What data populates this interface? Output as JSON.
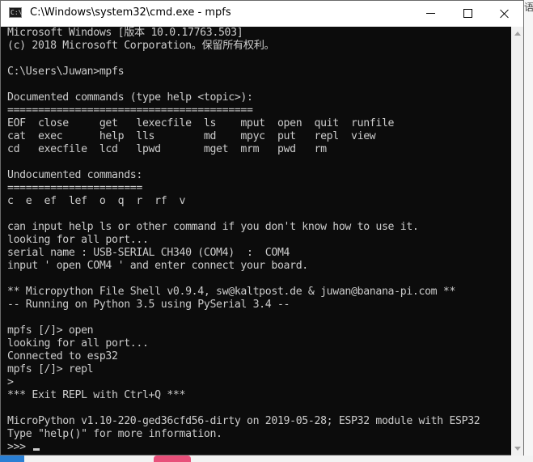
{
  "window": {
    "title": "C:\\Windows\\system32\\cmd.exe - mpfs",
    "icon": "cmd-icon",
    "icon_glyph": "C:\\"
  },
  "controls": {
    "minimize_icon": "minimize-icon",
    "maximize_icon": "maximize-icon",
    "close_icon": "close-icon"
  },
  "console": {
    "lines": [
      "Microsoft Windows [版本 10.0.17763.503]",
      "(c) 2018 Microsoft Corporation。保留所有权利。",
      "",
      "C:\\Users\\Juwan>mpfs",
      "",
      "Documented commands (type help <topic>):",
      "========================================",
      "EOF  close     get   lexecfile  ls    mput  open  quit  runfile",
      "cat  exec      help  lls        md    mpyc  put   repl  view",
      "cd   execfile  lcd   lpwd       mget  mrm   pwd   rm",
      "",
      "Undocumented commands:",
      "======================",
      "c  e  ef  lef  o  q  r  rf  v",
      "",
      "can input help ls or other command if you don't know how to use it.",
      "looking for all port...",
      "serial name : USB-SERIAL CH340 (COM4)  :  COM4",
      "input ' open COM4 ' and enter connect your board.",
      "",
      "** Micropython File Shell v0.9.4, sw@kaltpost.de & juwan@banana-pi.com **",
      "-- Running on Python 3.5 using PySerial 3.4 --",
      "",
      "mpfs [/]> open",
      "looking for all port...",
      "Connected to esp32",
      "mpfs [/]> repl",
      ">",
      "*** Exit REPL with Ctrl+Q ***",
      "",
      "MicroPython v1.10-220-ged36cfd56-dirty on 2019-05-28; ESP32 module with ESP32",
      "Type \"help()\" for more information."
    ],
    "prompt": ">>> "
  },
  "colors": {
    "console_bg": "#0c0c0c",
    "console_fg": "#cccccc",
    "titlebar_bg": "#ffffff"
  }
}
